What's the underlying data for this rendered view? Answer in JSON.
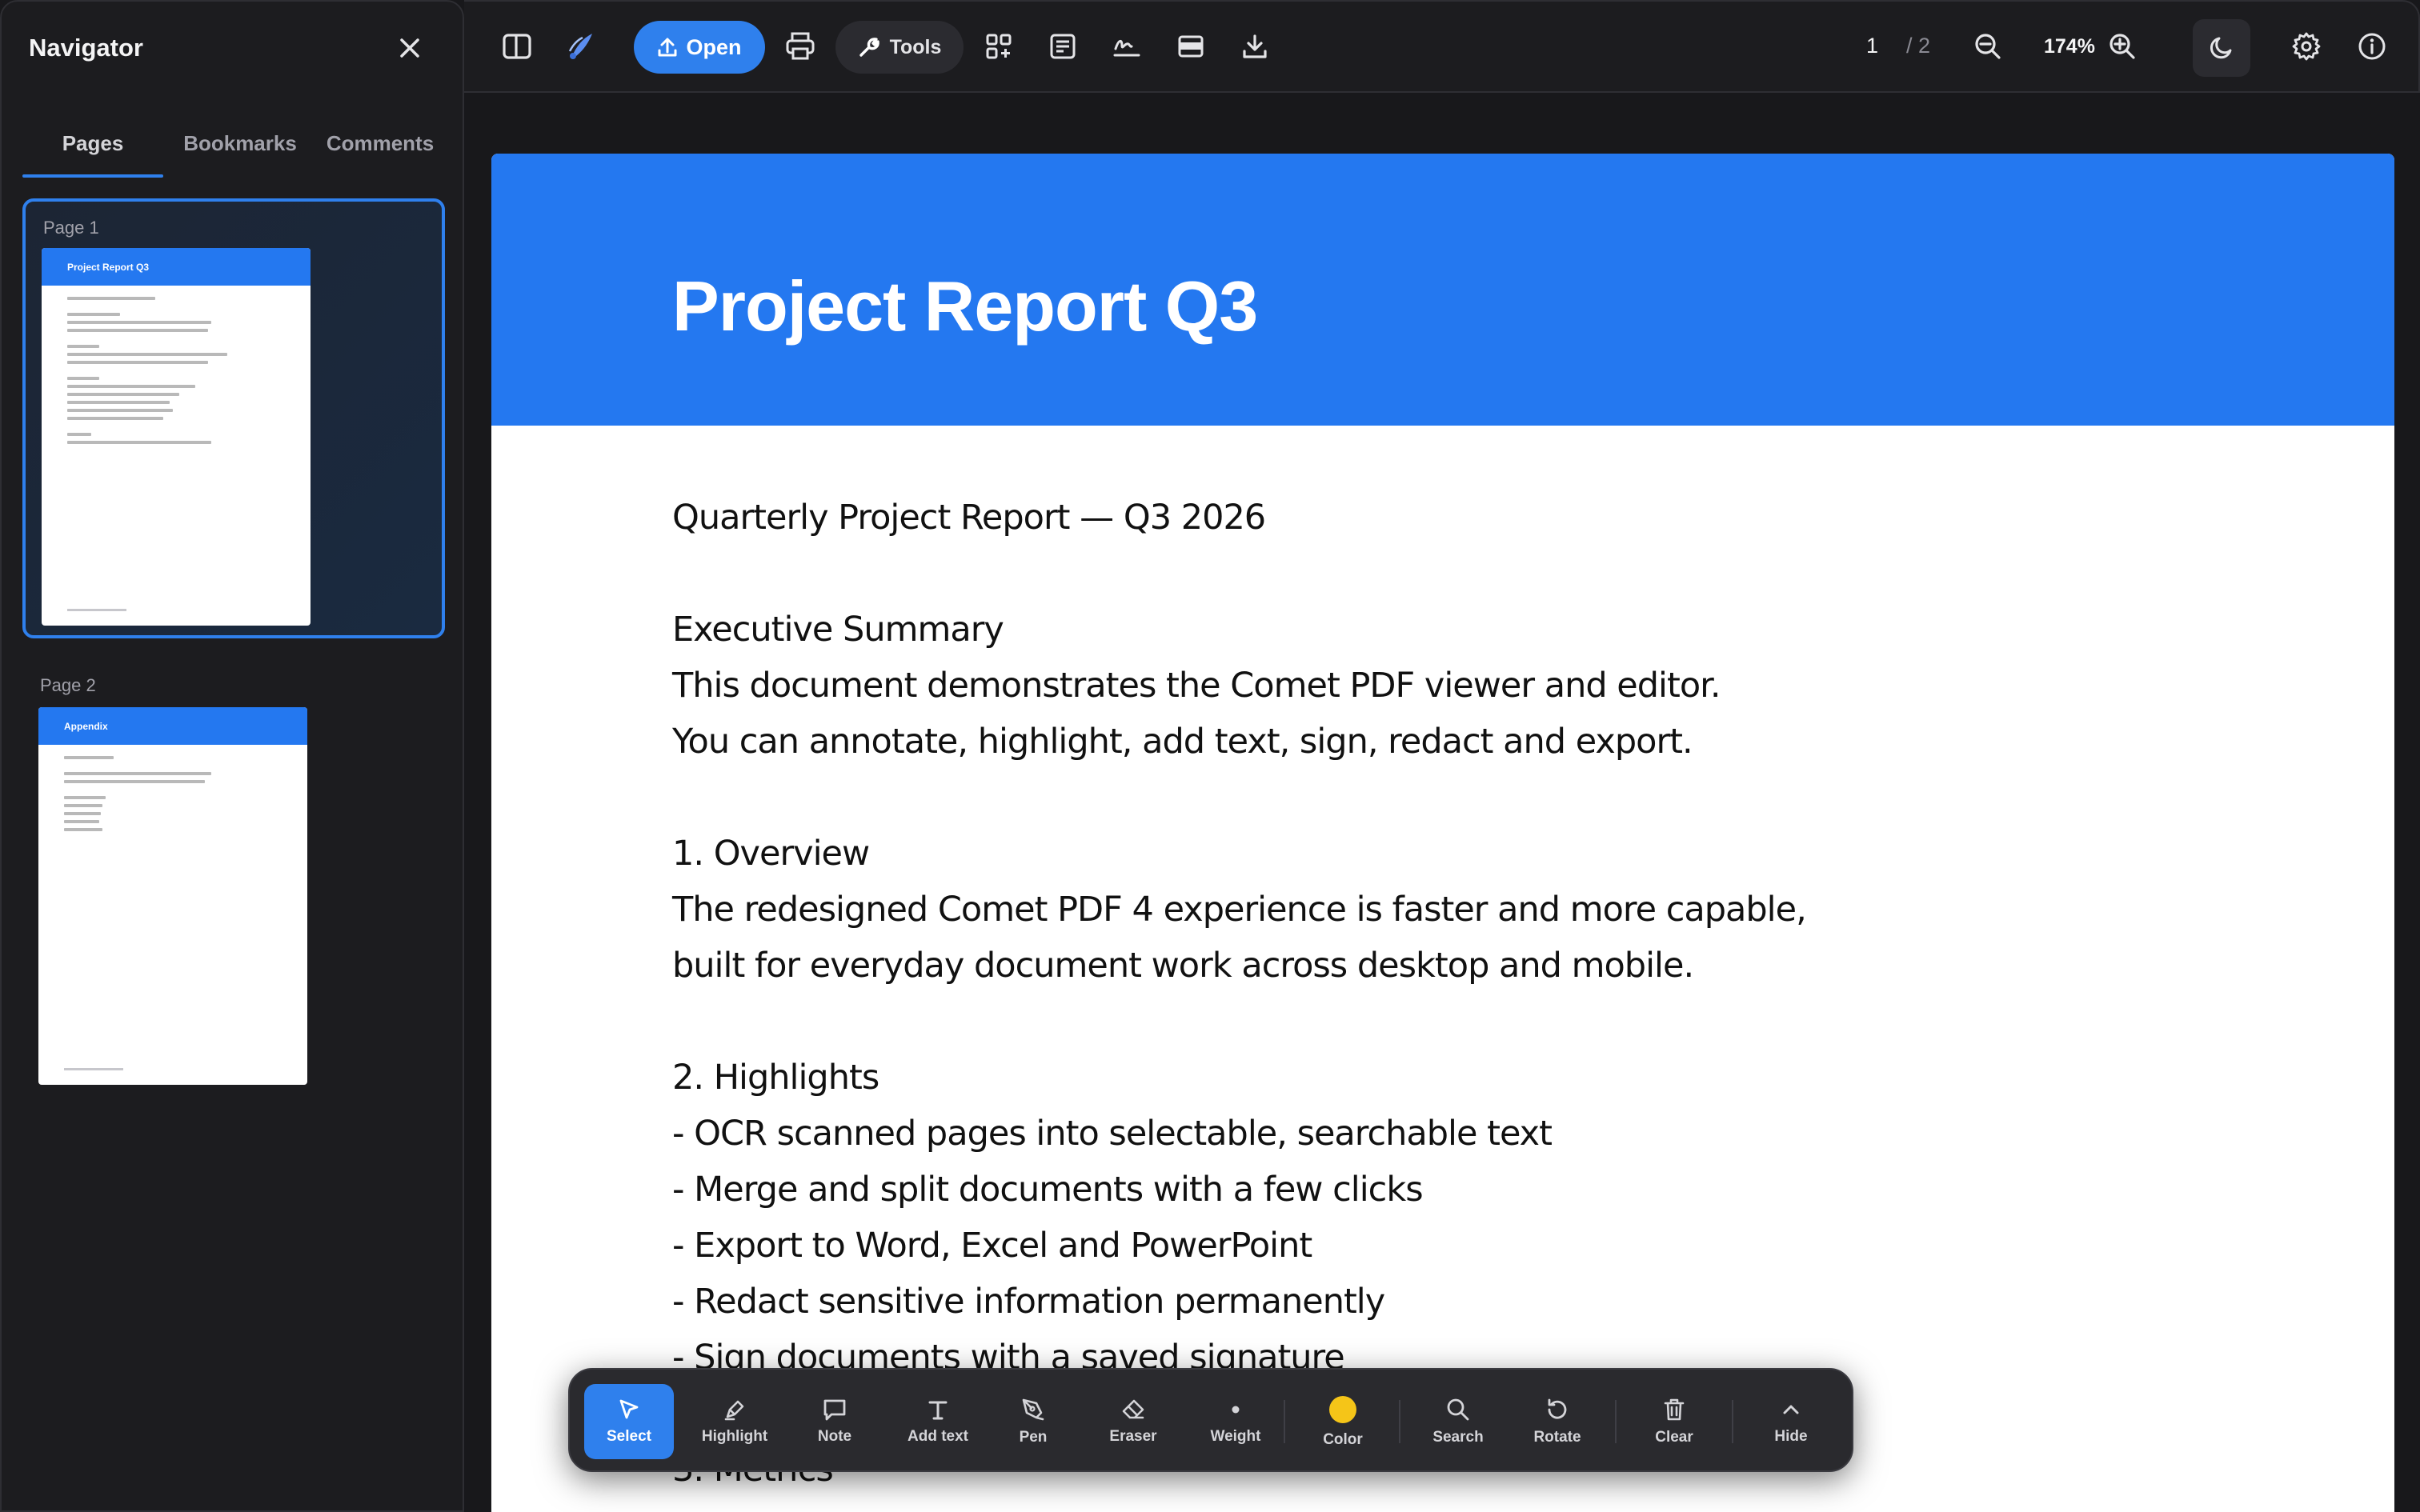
{
  "sidebar": {
    "title": "Navigator",
    "tabs": [
      {
        "label": "Pages",
        "active": true
      },
      {
        "label": "Bookmarks",
        "active": false
      },
      {
        "label": "Comments",
        "active": false
      }
    ],
    "thumbnails": [
      {
        "label": "Page 1",
        "heading": "Project Report Q3",
        "active": true
      },
      {
        "label": "Page 2",
        "heading": "Appendix",
        "active": false
      }
    ]
  },
  "toolbar": {
    "open_label": "Open",
    "tools_label": "Tools",
    "page_current": "1",
    "page_total": "/ 2",
    "zoom": "174%"
  },
  "document": {
    "title": "Project Report Q3",
    "lines": [
      "Quarterly Project Report — Q3 2026",
      "",
      "Executive Summary",
      "This document demonstrates the Comet PDF viewer and editor.",
      "You can annotate, highlight, add text, sign, redact and export.",
      "",
      "1. Overview",
      "The redesigned Comet PDF 4 experience is faster and more capable,",
      "built for everyday document work across desktop and mobile.",
      "",
      "2. Highlights",
      "- OCR scanned pages into selectable, searchable text",
      "- Merge and split documents with a few clicks",
      "- Export to Word, Excel and PowerPoint",
      "- Redact sensitive information permanently",
      "- Sign documents with a saved signature",
      "",
      "3. Metrics"
    ]
  },
  "annotation_bar": {
    "items": [
      {
        "label": "Select",
        "icon": "cursor-icon",
        "active": true
      },
      {
        "label": "Highlight",
        "icon": "highlighter-icon"
      },
      {
        "label": "Note",
        "icon": "note-icon"
      },
      {
        "label": "Add text",
        "icon": "text-icon"
      },
      {
        "label": "Pen",
        "icon": "pen-icon"
      },
      {
        "label": "Eraser",
        "icon": "eraser-icon"
      },
      {
        "label": "Weight",
        "icon": "dot-icon"
      },
      {
        "label": "Color",
        "icon": "color-swatch-icon",
        "color": "#f5c518"
      },
      {
        "label": "Search",
        "icon": "search-icon"
      },
      {
        "label": "Rotate",
        "icon": "rotate-icon"
      },
      {
        "label": "Clear",
        "icon": "trash-icon"
      },
      {
        "label": "Hide",
        "icon": "chevron-up-icon"
      }
    ]
  },
  "colors": {
    "accent": "#2f80ed",
    "doc_header": "#2478f0"
  }
}
